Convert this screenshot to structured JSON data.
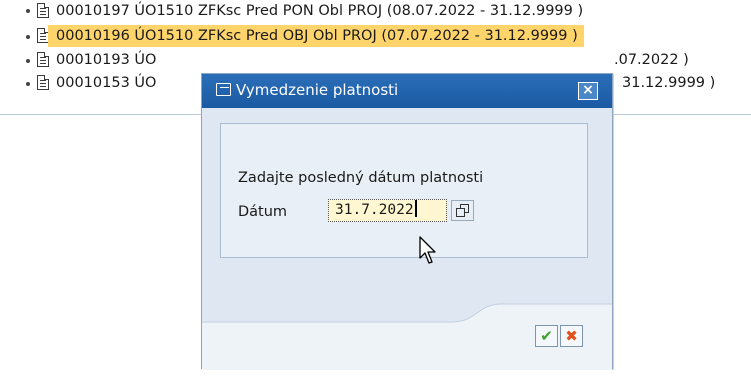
{
  "tree": {
    "rows": [
      {
        "text": "00010197 ÚO1510 ZFKsc  Pred PON Obl PROJ (08.07.2022 - 31.12.9999 )"
      },
      {
        "text": "00010196 ÚO1510 ZFKsc  Pred OBJ Obl PROJ (07.07.2022 - 31.12.9999 )",
        "selected": true
      },
      {
        "text": "00010193 ÚO",
        "tail": ".07.2022 )"
      },
      {
        "text": "00010153 ÚO",
        "tail": "31.12.9999 )"
      }
    ],
    "selected_color": "#ffd56b"
  },
  "dialog": {
    "title": "Vymedzenie platnosti",
    "close_symbol": "×",
    "prompt": "Zadajte posledný dátum platnosti",
    "field_label": "Dátum",
    "date_value": "31.7.2022",
    "ok_symbol": "✔",
    "cancel_symbol": "✖",
    "title_bar_color": "#1f63ad",
    "ok_color": "#3da22c",
    "cancel_color": "#e2501c"
  },
  "icons": {
    "row_icon": "document-icon",
    "title_icon": "window-icon",
    "value_help_icon": "multiple-selection-icon",
    "pointer": "mouse-pointer-icon"
  }
}
